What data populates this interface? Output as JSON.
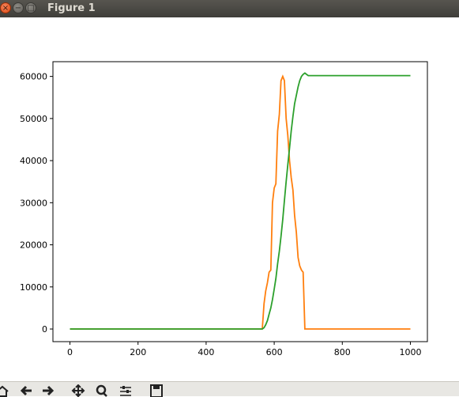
{
  "window": {
    "title": "Figure 1",
    "close_glyph": "×",
    "min_glyph": "−",
    "max_glyph": "□"
  },
  "toolbar": {
    "tools": [
      "home-icon",
      "back-icon",
      "forward-icon",
      "pan-icon",
      "zoom-icon",
      "configure-icon",
      "save-icon"
    ]
  },
  "chart_data": {
    "type": "line",
    "title": "",
    "xlabel": "",
    "ylabel": "",
    "xlim": [
      -50,
      1050
    ],
    "ylim": [
      -3000,
      63500
    ],
    "xticks": [
      0,
      200,
      400,
      600,
      800,
      1000
    ],
    "yticks": [
      0,
      10000,
      20000,
      30000,
      40000,
      50000,
      60000
    ],
    "grid": false,
    "series": [
      {
        "color": "#ff7f0e",
        "x": [
          0,
          565,
          570,
          575,
          580,
          585,
          590,
          595,
          600,
          605,
          610,
          615,
          620,
          625,
          630,
          635,
          640,
          645,
          650,
          655,
          660,
          665,
          670,
          675,
          680,
          685,
          690,
          695,
          700,
          1000
        ],
        "y": [
          0,
          0,
          6000,
          9000,
          11000,
          13500,
          14000,
          30000,
          33500,
          34500,
          47000,
          51000,
          59000,
          60000,
          59000,
          50000,
          46000,
          40000,
          36000,
          33000,
          27000,
          23000,
          17000,
          15000,
          14000,
          13500,
          0,
          0,
          0,
          0
        ]
      },
      {
        "color": "#2ca02c",
        "x": [
          0,
          565,
          570,
          575,
          580,
          585,
          590,
          595,
          600,
          605,
          610,
          615,
          620,
          625,
          630,
          635,
          640,
          645,
          650,
          655,
          660,
          665,
          670,
          675,
          680,
          685,
          690,
          695,
          700,
          705,
          710,
          1000
        ],
        "y": [
          0,
          0,
          300,
          1000,
          2000,
          3500,
          5000,
          7000,
          9500,
          12000,
          15500,
          18500,
          22000,
          26000,
          30500,
          35000,
          39000,
          43000,
          47000,
          50500,
          53500,
          55500,
          57500,
          59000,
          60000,
          60500,
          60800,
          60500,
          60200,
          60200,
          60200,
          60200
        ]
      }
    ]
  }
}
